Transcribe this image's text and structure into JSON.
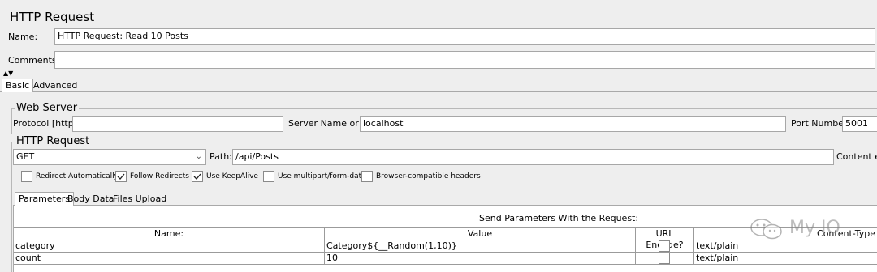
{
  "header": {
    "title": "HTTP Request"
  },
  "name_row": {
    "label": "Name:",
    "value": "HTTP Request: Read 10 Posts"
  },
  "comments_row": {
    "label": "Comments:",
    "value": ""
  },
  "tabs": {
    "basic": "Basic",
    "advanced": "Advanced"
  },
  "web_server": {
    "legend": "Web Server",
    "protocol_label": "Protocol [http]:",
    "protocol_value": "",
    "server_label": "Server Name or IP:",
    "server_value": "localhost",
    "port_label": "Port Number:",
    "port_value": "5001"
  },
  "http_request": {
    "legend": "HTTP Request",
    "method": "GET",
    "path_label": "Path:",
    "path_value": "/api/Posts",
    "content_encoding_label": "Content en"
  },
  "options": [
    {
      "label": "Redirect Automatically",
      "checked": false
    },
    {
      "label": "Follow Redirects",
      "checked": true
    },
    {
      "label": "Use KeepAlive",
      "checked": true
    },
    {
      "label": "Use multipart/form-data",
      "checked": false
    },
    {
      "label": "Browser-compatible headers",
      "checked": false
    }
  ],
  "subtabs": {
    "parameters": "Parameters",
    "body_data": "Body Data",
    "files_upload": "Files Upload"
  },
  "params_table": {
    "caption": "Send Parameters With the Request:",
    "columns": {
      "name": "Name:",
      "value": "Value",
      "url_encode": "URL Encode?",
      "content_type": "Content-Type"
    },
    "rows": [
      {
        "name": "category",
        "value": "Category${__Random(1,10)}",
        "encode": false,
        "content_type": "text/plain"
      },
      {
        "name": "count",
        "value": "10",
        "encode": false,
        "content_type": "text/plain"
      }
    ]
  },
  "watermark": {
    "text": "My IO"
  }
}
